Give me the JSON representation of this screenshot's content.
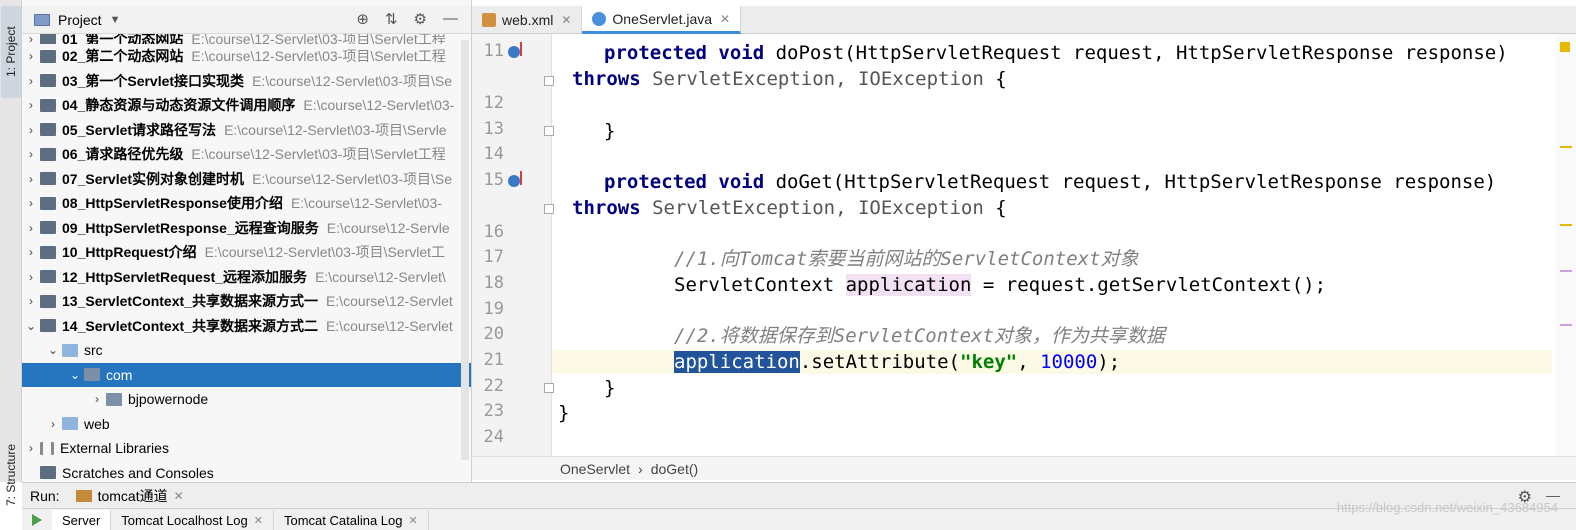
{
  "stripe": {
    "project_tab": "1: Project",
    "structure_tab": "7: Structure"
  },
  "project_panel": {
    "title": "Project",
    "items": [
      {
        "name": "01_第一个动态网站",
        "path": "E:\\course\\12-Servlet\\03-项目\\Servlet工程"
      },
      {
        "name": "02_第二个动态网站",
        "path": "E:\\course\\12-Servlet\\03-项目\\Servlet工程"
      },
      {
        "name": "03_第一个Servlet接口实现类",
        "path": "E:\\course\\12-Servlet\\03-项目\\Se"
      },
      {
        "name": "04_静态资源与动态资源文件调用顺序",
        "path": "E:\\course\\12-Servlet\\03-"
      },
      {
        "name": "05_Servlet请求路径写法",
        "path": "E:\\course\\12-Servlet\\03-项目\\Servle"
      },
      {
        "name": "06_请求路径优先级",
        "path": "E:\\course\\12-Servlet\\03-项目\\Servlet工程"
      },
      {
        "name": "07_Servlet实例对象创建时机",
        "path": "E:\\course\\12-Servlet\\03-项目\\Se"
      },
      {
        "name": "08_HttpServletResponse使用介绍",
        "path": "E:\\course\\12-Servlet\\03-"
      },
      {
        "name": "09_HttpServletResponse_远程查询服务",
        "path": "E:\\course\\12-Servle"
      },
      {
        "name": "10_HttpRequest介绍",
        "path": "E:\\course\\12-Servlet\\03-项目\\Servlet工"
      },
      {
        "name": "12_HttpServletRequest_远程添加服务",
        "path": "E:\\course\\12-Servlet\\"
      },
      {
        "name": "13_ServletContext_共享数据来源方式一",
        "path": "E:\\course\\12-Servlet"
      },
      {
        "name": "14_ServletContext_共享数据来源方式二",
        "path": "E:\\course\\12-Servlet"
      }
    ],
    "src": "src",
    "com": "com",
    "bjpowernode": "bjpowernode",
    "web": "web",
    "external_libraries": "External Libraries",
    "scratches": "Scratches and Consoles"
  },
  "editor": {
    "tabs": [
      {
        "label": "web.xml"
      },
      {
        "label": "OneServlet.java"
      }
    ],
    "lines": {
      "n11": "11",
      "n12": "12",
      "n13": "13",
      "n14": "14",
      "n15": "15",
      "n16": "16",
      "n17": "17",
      "n18": "18",
      "n19": "19",
      "n20": "20",
      "n21": "21",
      "n22": "22",
      "n23": "23",
      "n24": "24"
    },
    "code": {
      "l11_kw": "protected void ",
      "l11_rest": "doPost(HttpServletRequest request, HttpServletResponse response)",
      "l11b_kw": "throws ",
      "l11b_ty": "ServletException, IOException",
      "l11b_rest": " {",
      "l13": "}",
      "l15_kw": "protected void ",
      "l15_rest": "doGet(HttpServletRequest request, HttpServletResponse response)",
      "l15b_kw": "throws ",
      "l15b_ty": "ServletException, IOException",
      "l15b_rest": " {",
      "l17": "//1.向Tomcat索要当前网站的ServletContext对象",
      "l18_a": "ServletContext ",
      "l18_var": "application",
      "l18_b": " = request.getServletContext();",
      "l20": "//2.将数据保存到ServletContext对象，作为共享数据",
      "l21_var": "application",
      "l21_a": ".setAttribute(",
      "l21_str": "\"key\"",
      "l21_b": ", ",
      "l21_num": "10000",
      "l21_c": ");",
      "l22": "}",
      "l23": "}"
    },
    "breadcrumb": {
      "class": "OneServlet",
      "sep": "›",
      "method": "doGet()"
    }
  },
  "run": {
    "label": "Run:",
    "config": "tomcat通道",
    "tabs": [
      {
        "label": "Server"
      },
      {
        "label": "Tomcat Localhost Log"
      },
      {
        "label": "Tomcat Catalina Log"
      }
    ]
  },
  "watermark": "https://blog.csdn.net/weixin_43684954"
}
